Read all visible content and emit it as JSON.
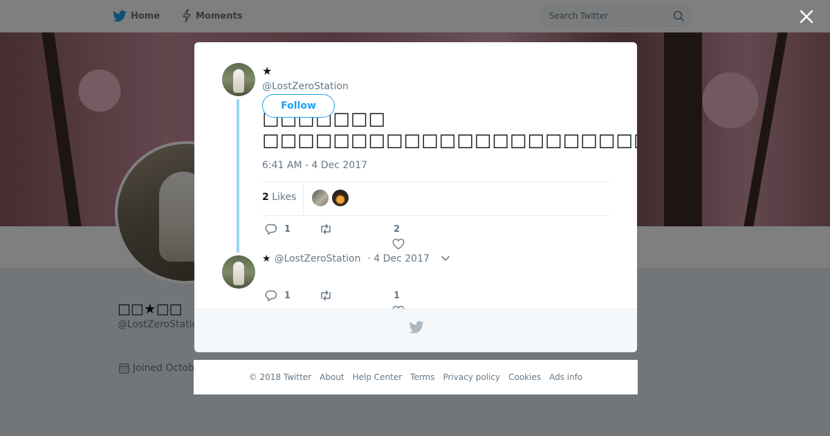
{
  "nav": {
    "home_label": "Home",
    "moments_label": "Moments",
    "search_placeholder": "Search Twitter"
  },
  "profile": {
    "name": "□□★□□",
    "handle": "@LostZeroStation",
    "joined": "Joined October"
  },
  "tweet": {
    "author_name": "★",
    "author_handle": "@LostZeroStation",
    "follow_label": "Follow",
    "text_line1": "□□□□□□□",
    "text_line2": "□□□□□□□□□□□□□□□□□□□□□□",
    "timestamp": "6:41 AM - 4 Dec 2017",
    "likes_count": "2",
    "likes_label": "Likes",
    "reply_count": "1",
    "like_count": "2"
  },
  "reply_tweet": {
    "author_name": "★",
    "author_handle": "@LostZeroStation",
    "date": "· 4 Dec 2017",
    "reply_count": "1",
    "like_count": "1"
  },
  "footer": {
    "copyright": "© 2018 Twitter",
    "links": [
      "About",
      "Help Center",
      "Terms",
      "Privacy policy",
      "Cookies",
      "Ads info"
    ]
  },
  "colors": {
    "brand": "#1da1f2",
    "thread_line": "#9fd2f2",
    "secondary_text": "#657786"
  }
}
